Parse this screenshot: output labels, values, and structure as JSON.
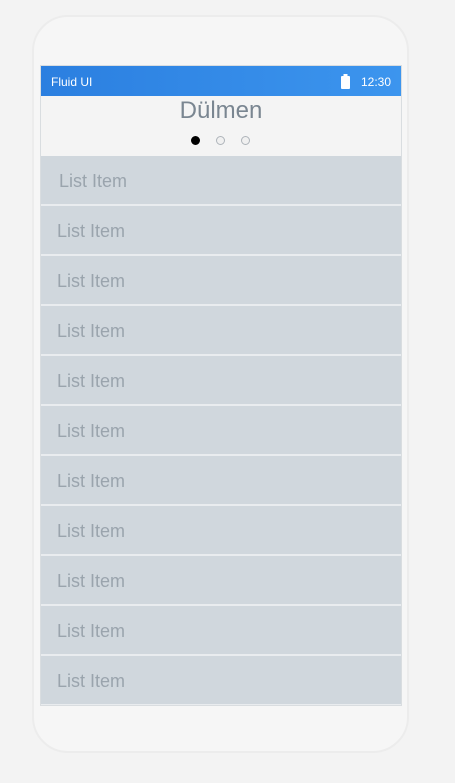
{
  "status_bar": {
    "app_name": "Fluid UI",
    "time": "12:30",
    "battery_icon": "battery-icon"
  },
  "header": {
    "title": "Dülmen"
  },
  "pager": {
    "current_page": 1,
    "page_count": 3
  },
  "list": {
    "items": [
      {
        "label": "List Item"
      },
      {
        "label": "List Item"
      },
      {
        "label": "List Item"
      },
      {
        "label": "List Item"
      },
      {
        "label": "List Item"
      },
      {
        "label": "List Item"
      },
      {
        "label": "List Item"
      },
      {
        "label": "List Item"
      },
      {
        "label": "List Item"
      },
      {
        "label": "List Item"
      },
      {
        "label": "List Item"
      }
    ]
  },
  "colors": {
    "status_bar": "#2b7fe0",
    "list_item_background": "#d0d7dd",
    "list_item_text": "#9aa4ad",
    "title_text": "#7a8691"
  }
}
